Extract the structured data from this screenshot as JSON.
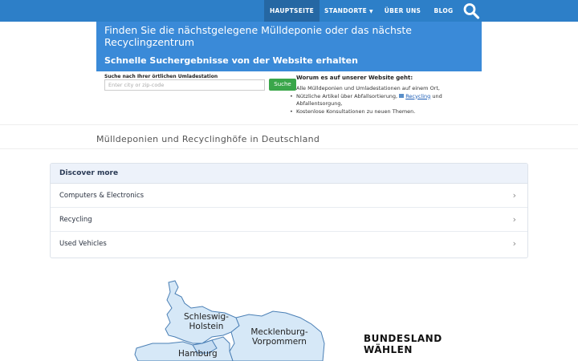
{
  "nav": {
    "items": [
      {
        "label": "HAUPTSEITE"
      },
      {
        "label": "STANDORTE"
      },
      {
        "label": "ÜBER UNS"
      },
      {
        "label": "BLOG"
      }
    ],
    "search_icon": "search-icon",
    "colors": {
      "bar": "#2d7fc8",
      "active": "#2567a3"
    }
  },
  "hero": {
    "title": "Finden Sie die nächstgelegene Mülldeponie oder das nächste Recyclingzentrum",
    "subtitle": "Schnelle Suchergebnisse von der Website erhalten",
    "color": "#3a8ad8"
  },
  "search": {
    "label": "Suche nach Ihrer örtlichen Umladestation",
    "placeholder": "Enter city or zip-code",
    "button": "Suche",
    "button_color": "#3aa64a"
  },
  "info": {
    "title": "Worum es auf unserer Website geht:",
    "line1": "Alle Mülldeponien und Umladestationen auf einem Ort,",
    "line2_pre": "Nützliche Artikel über Abfallsortierung,",
    "line2_link": "Recycling",
    "line2_post": "und",
    "line3": "Abfallentsorgung,",
    "line4": "Kostenlose Konsultationen zu neuen Themen."
  },
  "section_title": "Mülldeponien und Recyclinghöfe in Deutschland",
  "discover": {
    "heading": "Discover more",
    "items": [
      {
        "label": "Computers & Electronics"
      },
      {
        "label": "Recycling"
      },
      {
        "label": "Used Vehicles"
      }
    ]
  },
  "map": {
    "regions": [
      {
        "name": "Schleswig-Holstein"
      },
      {
        "name": "Mecklenburg-Vorpommern"
      },
      {
        "name": "Hamburg"
      }
    ],
    "fill": "#d6e8f7"
  },
  "bundesland": {
    "line1": "BUNDESLAND",
    "line2": "WÄHLEN"
  }
}
